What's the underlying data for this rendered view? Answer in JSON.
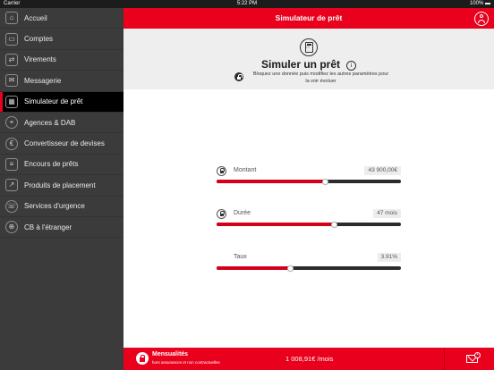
{
  "status_bar": {
    "carrier": "Carrier",
    "time": "5:22 PM",
    "battery": "100%"
  },
  "sidebar": {
    "items": [
      {
        "label": "Accueil",
        "icon": "home-icon",
        "glyph": "⌂"
      },
      {
        "label": "Comptes",
        "icon": "wallet-icon",
        "glyph": "▭"
      },
      {
        "label": "Virements",
        "icon": "transfer-icon",
        "glyph": "⇄"
      },
      {
        "label": "Messagerie",
        "icon": "mail-icon",
        "glyph": "✉"
      },
      {
        "label": "Simulateur de prêt",
        "icon": "calculator-icon",
        "glyph": "▦"
      },
      {
        "label": "Agences & DAB",
        "icon": "location-pin-icon",
        "glyph": "⌖"
      },
      {
        "label": "Convertisseur de devises",
        "icon": "currency-icon",
        "glyph": "€"
      },
      {
        "label": "Encours de prêts",
        "icon": "list-icon",
        "glyph": "≡"
      },
      {
        "label": "Produits de placement",
        "icon": "chart-icon",
        "glyph": "↗"
      },
      {
        "label": "Services d'urgence",
        "icon": "emergency-phone-icon",
        "glyph": "☏"
      },
      {
        "label": "CB à l'étranger",
        "icon": "globe-icon",
        "glyph": "⊕"
      }
    ],
    "active_index": 4
  },
  "header": {
    "title": "Simulateur de prêt",
    "profile_icon": "user-icon"
  },
  "intro": {
    "heading": "Simuler un prêt",
    "info_glyph": "i",
    "description": "Bloquez une donnée puis modifiez les autres paramètres pour la voir évoluer"
  },
  "params": [
    {
      "label": "Montant",
      "value": "43 900,00€",
      "level": 0.59,
      "lockable": true
    },
    {
      "label": "Durée",
      "value": "47 mois",
      "level": 0.64,
      "lockable": true
    },
    {
      "label": "Taux",
      "value": "3.91%",
      "level": 0.4,
      "lockable": false
    }
  ],
  "footer": {
    "title": "Mensualités",
    "subtitle": "hors assurances et non contractuelles",
    "amount": "1 008,91€ /mois",
    "mail_badge": "•"
  },
  "colors": {
    "accent": "#e8001c",
    "sidebar_bg": "#3b3b3b",
    "track": "#2b2b2b"
  }
}
